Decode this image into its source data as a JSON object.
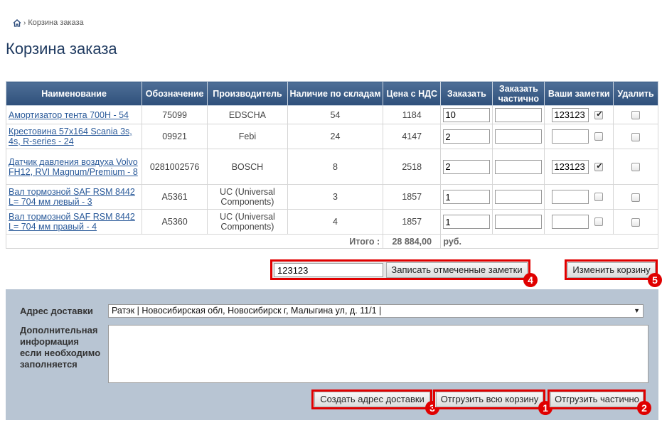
{
  "breadcrumb": {
    "home_icon": "home-icon",
    "separator": "›",
    "current": "Корзина заказа"
  },
  "page_title": "Корзина заказа",
  "table": {
    "headers": {
      "name": "Наименование",
      "code": "Обозначение",
      "maker": "Производитель",
      "stock": "Наличие по складам",
      "price": "Цена с НДС",
      "order": "Заказать",
      "partial_l1": "Заказать",
      "partial_l2": "частично",
      "notes": "Ваши заметки",
      "delete": "Удалить"
    },
    "rows": [
      {
        "name": "Амортизатор тента 700H - 54",
        "code": "75099",
        "maker": "EDSCHA",
        "stock": "54",
        "price": "1184",
        "qty": "10",
        "partial": "",
        "note": "123123",
        "note_checked": true,
        "delete_checked": false
      },
      {
        "name": "Крестовина 57x164 Scania 3s, 4s, R-series - 24",
        "code": "09921",
        "maker": "Febi",
        "stock": "24",
        "price": "4147",
        "qty": "2",
        "partial": "",
        "note": "",
        "note_checked": false,
        "delete_checked": false
      },
      {
        "name": "Датчик давления воздуха Volvo FH12, RVI Magnum/Premium - 8",
        "code": "0281002576",
        "maker": "BOSCH",
        "stock": "8",
        "price": "2518",
        "qty": "2",
        "partial": "",
        "note": "123123",
        "note_checked": true,
        "delete_checked": false
      },
      {
        "name": "Вал тормозной SAF RSM 8442 L= 704 мм левый - 3",
        "code": "A5361",
        "maker": "UC (Universal Components)",
        "stock": "3",
        "price": "1857",
        "qty": "1",
        "partial": "",
        "note": "",
        "note_checked": false,
        "delete_checked": false
      },
      {
        "name": "Вал тормозной SAF RSM 8442 L= 704 мм правый - 4",
        "code": "A5360",
        "maker": "UC (Universal Components)",
        "stock": "4",
        "price": "1857",
        "qty": "1",
        "partial": "",
        "note": "",
        "note_checked": false,
        "delete_checked": false
      }
    ],
    "total_label": "Итого :",
    "total_value": "28 884,00",
    "total_currency": "руб."
  },
  "notes_action": {
    "input_value": "123123",
    "button_label": "Записать отмеченные заметки",
    "badge": "4"
  },
  "change_cart": {
    "button_label": "Изменить корзину",
    "badge": "5"
  },
  "delivery": {
    "address_label": "Адрес доставки",
    "address_value": "Ратэк | Новосибирская обл, Новосибирск г, Малыгина ул, д. 11/1 |",
    "info_label_l1": "Дополнительная",
    "info_label_l2": "информация",
    "info_label_l3": "если необходимо",
    "info_label_l4": "заполняется",
    "info_value": "",
    "create_address_label": "Создать адрес доставки",
    "create_address_badge": "3",
    "ship_all_label": "Отгрузить всю корзину",
    "ship_all_badge": "1",
    "ship_partial_label": "Отгрузить частично",
    "ship_partial_badge": "2"
  },
  "colors": {
    "highlight": "#e00000",
    "header_bg": "#2e4f7a",
    "panel_bg": "#b8c5d3",
    "link": "#2a5a9a",
    "title": "#1f3a60"
  }
}
